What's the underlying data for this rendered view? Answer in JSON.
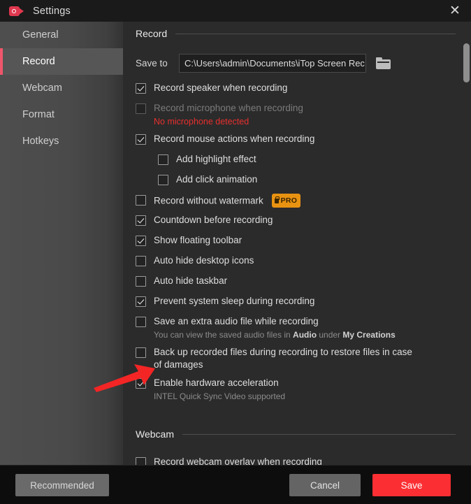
{
  "window": {
    "title": "Settings",
    "app_icon": "video-camera-icon",
    "close_label": "✕"
  },
  "sidebar": {
    "items": [
      {
        "label": "General",
        "active": false
      },
      {
        "label": "Record",
        "active": true
      },
      {
        "label": "Webcam",
        "active": false
      },
      {
        "label": "Format",
        "active": false
      },
      {
        "label": "Hotkeys",
        "active": false
      }
    ]
  },
  "main": {
    "record_section_title": "Record",
    "save_to": {
      "label": "Save to",
      "value": "C:\\Users\\admin\\Documents\\iTop Screen Rec",
      "browse_icon": "folder-icon"
    },
    "options": [
      {
        "label": "Record speaker when recording",
        "checked": true
      },
      {
        "label": "Record microphone when recording",
        "checked": false,
        "disabled": true,
        "warning": "No microphone detected"
      },
      {
        "label": "Record mouse actions when recording",
        "checked": true
      },
      {
        "label": "Add highlight effect",
        "checked": false,
        "indent": true
      },
      {
        "label": "Add click animation",
        "checked": false,
        "indent": true
      },
      {
        "label": "Record without watermark",
        "checked": false,
        "badge": "PRO"
      },
      {
        "label": "Countdown before recording",
        "checked": true
      },
      {
        "label": "Show floating toolbar",
        "checked": true
      },
      {
        "label": "Auto hide desktop icons",
        "checked": false
      },
      {
        "label": "Auto hide taskbar",
        "checked": false
      },
      {
        "label": "Prevent system sleep during recording",
        "checked": true
      },
      {
        "label": "Save an extra audio file while recording",
        "checked": false,
        "sub_pre": "You can view the saved audio files in ",
        "sub_b1": "Audio",
        "sub_mid": " under ",
        "sub_b2": "My Creations"
      },
      {
        "label": "Back up recorded files during recording to restore files in case of damages",
        "checked": false
      },
      {
        "label": "Enable hardware acceleration",
        "checked": true,
        "sub": "INTEL Quick Sync Video supported"
      }
    ],
    "webcam_section_title": "Webcam",
    "webcam_option": {
      "label": "Record webcam overlay when recording",
      "checked": false
    }
  },
  "footer": {
    "recommended_label": "Recommended",
    "cancel_label": "Cancel",
    "save_label": "Save"
  },
  "colors": {
    "accent_red": "#fb2f33",
    "sidebar_active_bar": "#f0566b",
    "pro_badge": "#e89212",
    "warning_text": "#e6302e",
    "annotation_arrow": "#f32525"
  }
}
